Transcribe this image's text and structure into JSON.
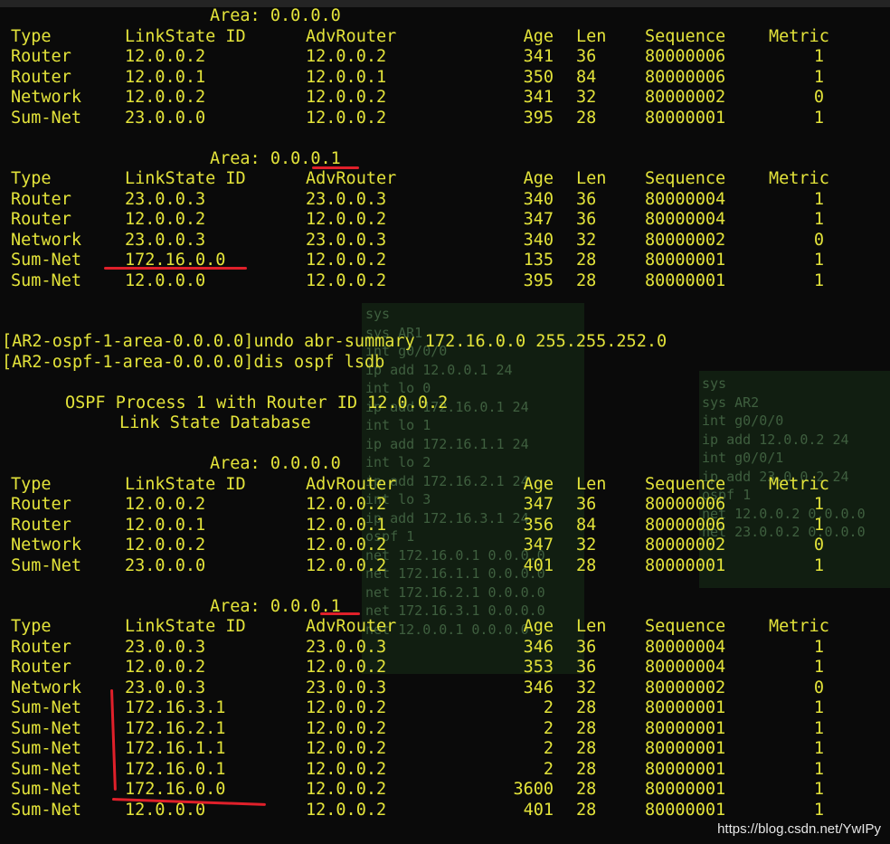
{
  "window": {
    "title": "terminal - dis ospf lsdb"
  },
  "columns": [
    "Type",
    "LinkState ID",
    "AdvRouter",
    "Age",
    "Len",
    "Sequence",
    "Metric"
  ],
  "block1": {
    "area0": {
      "label": "Area: 0.0.0.0",
      "rows": [
        [
          "Router",
          "12.0.0.2",
          "12.0.0.2",
          "341",
          "36",
          "80000006",
          "1"
        ],
        [
          "Router",
          "12.0.0.1",
          "12.0.0.1",
          "350",
          "84",
          "80000006",
          "1"
        ],
        [
          "Network",
          "12.0.0.2",
          "12.0.0.2",
          "341",
          "32",
          "80000002",
          "0"
        ],
        [
          "Sum-Net",
          "23.0.0.0",
          "12.0.0.2",
          "395",
          "28",
          "80000001",
          "1"
        ]
      ]
    },
    "area1": {
      "label": "Area: 0.0.0.1",
      "rows": [
        [
          "Router",
          "23.0.0.3",
          "23.0.0.3",
          "340",
          "36",
          "80000004",
          "1"
        ],
        [
          "Router",
          "12.0.0.2",
          "12.0.0.2",
          "347",
          "36",
          "80000004",
          "1"
        ],
        [
          "Network",
          "23.0.0.3",
          "23.0.0.3",
          "340",
          "32",
          "80000002",
          "0"
        ],
        [
          "Sum-Net",
          "172.16.0.0",
          "12.0.0.2",
          "135",
          "28",
          "80000001",
          "1"
        ],
        [
          "Sum-Net",
          "12.0.0.0",
          "12.0.0.2",
          "395",
          "28",
          "80000001",
          "1"
        ]
      ]
    }
  },
  "commands": [
    "[AR2-ospf-1-area-0.0.0.0]undo abr-summary 172.16.0.0 255.255.252.0",
    "[AR2-ospf-1-area-0.0.0.0]dis ospf lsdb"
  ],
  "process_header": "OSPF Process 1 with Router ID 12.0.0.2",
  "db_header": "Link State Database",
  "block2": {
    "area0": {
      "label": "Area: 0.0.0.0",
      "rows": [
        [
          "Router",
          "12.0.0.2",
          "12.0.0.2",
          "347",
          "36",
          "80000006",
          "1"
        ],
        [
          "Router",
          "12.0.0.1",
          "12.0.0.1",
          "356",
          "84",
          "80000006",
          "1"
        ],
        [
          "Network",
          "12.0.0.2",
          "12.0.0.2",
          "347",
          "32",
          "80000002",
          "0"
        ],
        [
          "Sum-Net",
          "23.0.0.0",
          "12.0.0.2",
          "401",
          "28",
          "80000001",
          "1"
        ]
      ]
    },
    "area1": {
      "label": "Area: 0.0.0.1",
      "rows": [
        [
          "Router",
          "23.0.0.3",
          "23.0.0.3",
          "346",
          "36",
          "80000004",
          "1"
        ],
        [
          "Router",
          "12.0.0.2",
          "12.0.0.2",
          "353",
          "36",
          "80000004",
          "1"
        ],
        [
          "Network",
          "23.0.0.3",
          "23.0.0.3",
          "346",
          "32",
          "80000002",
          "0"
        ],
        [
          "Sum-Net",
          "172.16.3.1",
          "12.0.0.2",
          "2",
          "28",
          "80000001",
          "1"
        ],
        [
          "Sum-Net",
          "172.16.2.1",
          "12.0.0.2",
          "2",
          "28",
          "80000001",
          "1"
        ],
        [
          "Sum-Net",
          "172.16.1.1",
          "12.0.0.2",
          "2",
          "28",
          "80000001",
          "1"
        ],
        [
          "Sum-Net",
          "172.16.0.1",
          "12.0.0.2",
          "2",
          "28",
          "80000001",
          "1"
        ],
        [
          "Sum-Net",
          "172.16.0.0",
          "12.0.0.2",
          "3600",
          "28",
          "80000001",
          "1"
        ],
        [
          "Sum-Net",
          "12.0.0.0",
          "12.0.0.2",
          "401",
          "28",
          "80000001",
          "1"
        ]
      ]
    }
  },
  "background_config_left": [
    "sys",
    "sys AR1",
    "int g0/0/0",
    "ip add 12.0.0.1 24",
    "int lo 0",
    "ip add 172.16.0.1 24",
    "int lo 1",
    "ip add 172.16.1.1 24",
    "int lo 2",
    "ip add 172.16.2.1 24",
    "int lo 3",
    "ip add 172.16.3.1 24",
    "ospf 1",
    "net 172.16.0.1 0.0.0.0",
    "net 172.16.1.1 0.0.0.0",
    "net 172.16.2.1 0.0.0.0",
    "net 172.16.3.1 0.0.0.0",
    "net 12.0.0.1 0.0.0.0"
  ],
  "background_config_right": [
    "sys",
    "sys AR2",
    "int g0/0/0",
    "ip add 12.0.0.2 24",
    "int g0/0/1",
    "ip add 23.0.0.2 24",
    "ospf 1",
    "net 12.0.0.2 0.0.0.0",
    "net 23.0.0.2 0.0.0.0"
  ],
  "watermark": "https://blog.csdn.net/YwIPy"
}
